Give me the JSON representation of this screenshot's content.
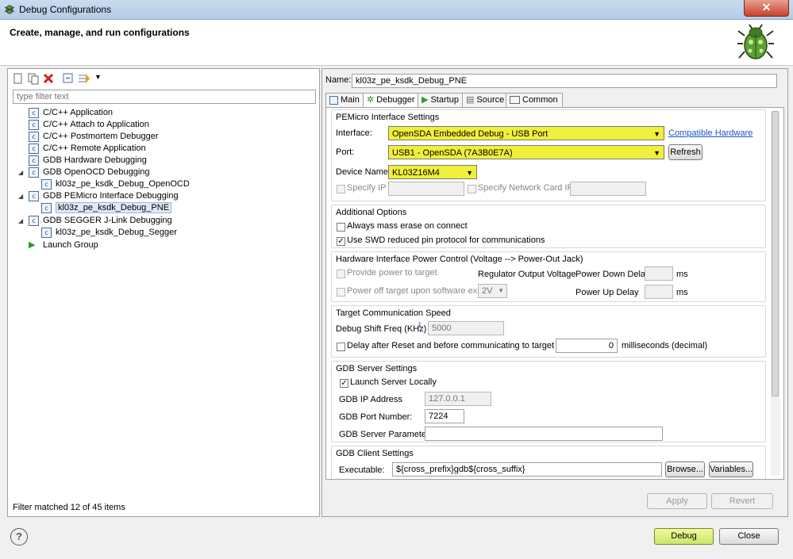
{
  "window": {
    "title": "Debug Configurations"
  },
  "header": {
    "title": "Create, manage, and run configurations"
  },
  "left": {
    "filter_placeholder": "type filter text",
    "tree": [
      {
        "label": "C/C++ Application"
      },
      {
        "label": "C/C++ Attach to Application"
      },
      {
        "label": "C/C++ Postmortem Debugger"
      },
      {
        "label": "C/C++ Remote Application"
      },
      {
        "label": "GDB Hardware Debugging"
      },
      {
        "label": "GDB OpenOCD Debugging"
      },
      {
        "label": "kl03z_pe_ksdk_Debug_OpenOCD"
      },
      {
        "label": "GDB PEMicro Interface Debugging"
      },
      {
        "label": "kl03z_pe_ksdk_Debug_PNE"
      },
      {
        "label": "GDB SEGGER J-Link Debugging"
      },
      {
        "label": "kl03z_pe_ksdk_Debug_Segger"
      },
      {
        "label": "Launch Group"
      }
    ],
    "filter_status": "Filter matched 12 of 45 items"
  },
  "right": {
    "name_label": "Name:",
    "name_value": "kl03z_pe_ksdk_Debug_PNE",
    "tabs": [
      "Main",
      "Debugger",
      "Startup",
      "Source",
      "Common"
    ],
    "pemicro": {
      "title": "PEMicro Interface Settings",
      "interface_label": "Interface:",
      "interface_value": "OpenSDA Embedded Debug - USB Port",
      "compatible_link": "Compatible Hardware",
      "port_label": "Port:",
      "port_value": "USB1 - OpenSDA (7A3B0E7A)",
      "refresh": "Refresh",
      "device_label": "Device Name:",
      "device_value": "KL03Z16M4",
      "specify_ip": "Specify IP",
      "specify_card": "Specify Network Card IP"
    },
    "additional": {
      "title": "Additional Options",
      "mass_erase": "Always mass erase on connect",
      "swd": "Use SWD reduced pin protocol for communications"
    },
    "power": {
      "title": "Hardware Interface Power Control (Voltage --> Power-Out Jack)",
      "provide_power": "Provide power to target",
      "regulator": "Regulator Output Voltage",
      "power_down": "Power Down Delay",
      "ms1": "ms",
      "power_off": "Power off target upon software exit",
      "voltage": "2V",
      "power_up": "Power Up Delay",
      "ms2": "ms"
    },
    "speed": {
      "title": "Target Communication Speed",
      "freq_label": "Debug Shift Freq (KHz)",
      "freq_value": "5000",
      "delay_label": "Delay after Reset and before communicating to target for",
      "delay_value": "0",
      "delay_unit": "milliseconds (decimal)"
    },
    "gdb_server": {
      "title": "GDB Server Settings",
      "launch_local": "Launch Server Locally",
      "ip_label": "GDB IP Address",
      "ip_value": "127.0.0.1",
      "port_label": "GDB Port Number:",
      "port_value": "7224",
      "params_label": "GDB Server Parameters:"
    },
    "gdb_client": {
      "title": "GDB Client Settings",
      "exe_label": "Executable:",
      "exe_value": "${cross_prefix}gdb${cross_suffix}",
      "browse": "Browse...",
      "variables": "Variables..."
    },
    "apply": "Apply",
    "revert": "Revert"
  },
  "footer": {
    "help": "?",
    "debug": "Debug",
    "close": "Close"
  },
  "colors": {
    "highlight": "#f0ef3c",
    "link": "#1a55c8"
  }
}
